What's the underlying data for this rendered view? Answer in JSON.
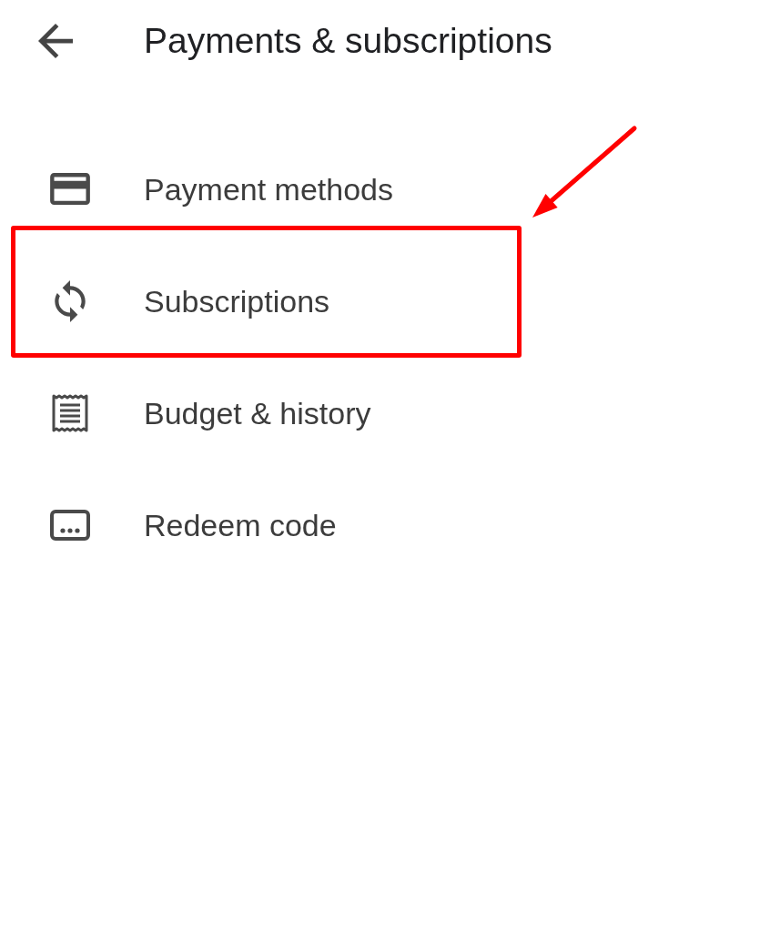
{
  "header": {
    "title": "Payments & subscriptions"
  },
  "menu": {
    "items": [
      {
        "label": "Payment methods",
        "highlighted": false
      },
      {
        "label": "Subscriptions",
        "highlighted": true
      },
      {
        "label": "Budget & history",
        "highlighted": false
      },
      {
        "label": "Redeem code",
        "highlighted": false
      }
    ]
  }
}
